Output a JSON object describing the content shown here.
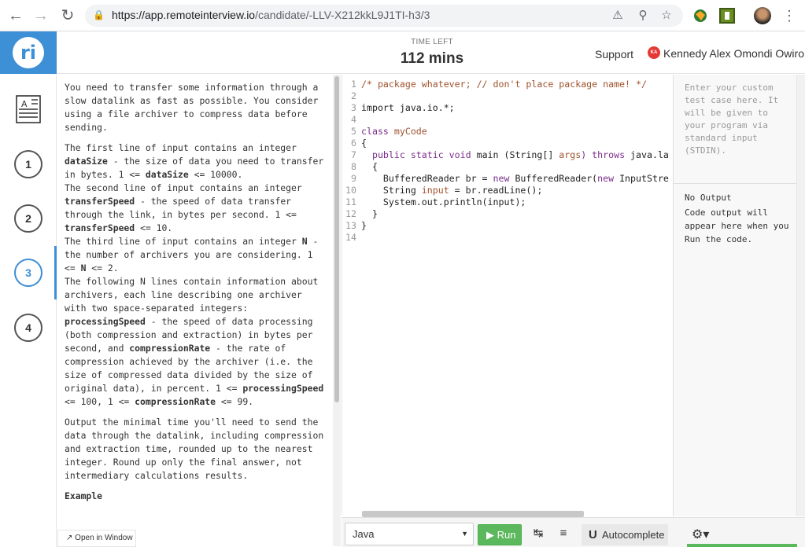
{
  "browser": {
    "url_host": "https://app.remoteinterview.io",
    "url_path": "/candidate/-LLV-X212kkL9J1TI-h3/3",
    "icons": [
      "back-arrow-icon",
      "forward-arrow-icon",
      "reload-icon",
      "lock-icon",
      "blocked-popup-icon",
      "zoom-icon",
      "star-icon",
      "extension-globe-icon",
      "extension-green-icon",
      "profile-avatar",
      "kebab-menu-icon"
    ]
  },
  "header": {
    "logo_text": "ri",
    "time_label": "TIME LEFT",
    "time_value": "112 mins",
    "support": "Support",
    "user_initials": "KA",
    "user_name": "Kennedy Alex Omondi Owiro"
  },
  "sidebar": {
    "questions": [
      "1",
      "2",
      "3",
      "4"
    ],
    "active_question": "3"
  },
  "problem": {
    "intro": "You need to transfer some information through a slow datalink as fast as possible. You consider using a file archiver to compress data before sending.",
    "l1a": "The first line of input contains an integer ",
    "l1b": "dataSize",
    "l1c": " - the size of data you need to transfer in bytes. 1 <= ",
    "l1d": "dataSize",
    "l1e": " <= 10000.",
    "l2a": "The second line of input contains an integer ",
    "l2b": "transferSpeed",
    "l2c": " - the speed of data transfer through the link, in bytes per second. 1 <= ",
    "l2d": "transferSpeed",
    "l2e": " <= 10.",
    "l3a": "The third line of input contains an integer ",
    "l3b": "N",
    "l3c": " - the number of archivers you are considering. 1 <= ",
    "l3d": "N",
    "l3e": " <= 2.",
    "l4a": "The following N lines contain information about archivers, each line describing one archiver with two space-separated integers: ",
    "l4b": "processingSpeed",
    "l4c": " - the speed of data processing (both compression and extraction) in bytes per second, and ",
    "l4d": "compressionRate",
    "l4e": " - the rate of compression achieved by the archiver (i.e. the size of compressed data divided by the size of original data), in percent. 1 <= ",
    "l4f": "processingSpeed",
    "l4g": " <= 100, 1 <= ",
    "l4h": "compressionRate",
    "l4i": " <= 99.",
    "output": "Output the minimal time you'll need to send the data through the datalink, including compression and extraction time, rounded up to the nearest integer. Round up only the final answer, not intermediary calculations results.",
    "example_heading": "Example",
    "open_window": "Open in Window"
  },
  "editor": {
    "lines": [
      {
        "n": "1",
        "parts": [
          {
            "t": "/* package whatever; // don't place package name! */",
            "c": "c-comment"
          }
        ]
      },
      {
        "n": "2",
        "parts": []
      },
      {
        "n": "3",
        "parts": [
          {
            "t": "import java.io.*;",
            "c": "c-plain"
          }
        ]
      },
      {
        "n": "4",
        "parts": []
      },
      {
        "n": "5",
        "parts": [
          {
            "t": "class ",
            "c": "c-kw"
          },
          {
            "t": "myCode",
            "c": "c-cls"
          }
        ]
      },
      {
        "n": "6",
        "parts": [
          {
            "t": "{",
            "c": "c-plain"
          }
        ]
      },
      {
        "n": "7",
        "parts": [
          {
            "t": "  public static void ",
            "c": "c-kw"
          },
          {
            "t": "main (String[] ",
            "c": "c-plain"
          },
          {
            "t": "args",
            "c": "c-cls"
          },
          {
            "t": ") throws ",
            "c": "c-kw"
          },
          {
            "t": "java.la",
            "c": "c-plain"
          }
        ]
      },
      {
        "n": "8",
        "parts": [
          {
            "t": "  {",
            "c": "c-plain"
          }
        ]
      },
      {
        "n": "9",
        "parts": [
          {
            "t": "    BufferedReader br = ",
            "c": "c-plain"
          },
          {
            "t": "new ",
            "c": "c-kw"
          },
          {
            "t": "BufferedReader(",
            "c": "c-plain"
          },
          {
            "t": "new ",
            "c": "c-kw"
          },
          {
            "t": "InputStre",
            "c": "c-plain"
          }
        ]
      },
      {
        "n": "10",
        "parts": [
          {
            "t": "    String ",
            "c": "c-plain"
          },
          {
            "t": "input",
            "c": "c-cls"
          },
          {
            "t": " = br.readLine();",
            "c": "c-plain"
          }
        ]
      },
      {
        "n": "11",
        "parts": [
          {
            "t": "    System.out.println(input);",
            "c": "c-plain"
          }
        ]
      },
      {
        "n": "12",
        "parts": [
          {
            "t": "  }",
            "c": "c-plain"
          }
        ]
      },
      {
        "n": "13",
        "parts": [
          {
            "t": "}",
            "c": "c-plain"
          }
        ]
      },
      {
        "n": "14",
        "parts": []
      }
    ]
  },
  "console": {
    "stdin_placeholder": "Enter your custom test case here. It will be given to your program via standard input (STDIN).",
    "output_title": "No Output",
    "output_body": "Code output will appear here when you Run the code."
  },
  "toolbar": {
    "language": "Java",
    "run_label": "Run",
    "autocomplete_label": "Autocomplete"
  },
  "colors": {
    "brand_blue": "#3d8fd6",
    "run_green": "#5cb85c",
    "badge_red": "#e53935"
  }
}
